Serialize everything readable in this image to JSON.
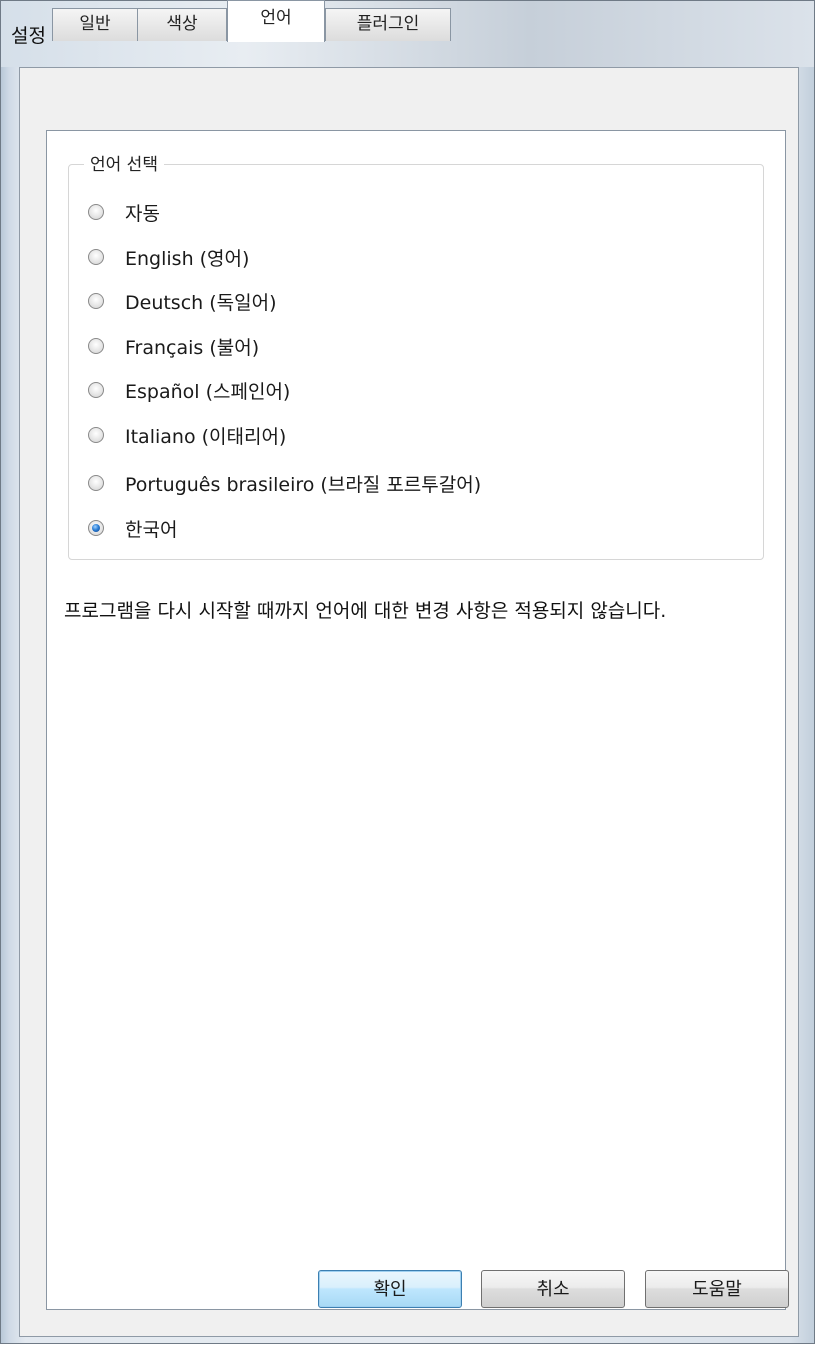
{
  "window": {
    "title": "설정"
  },
  "tabs": [
    {
      "label": "일반",
      "active": false
    },
    {
      "label": "색상",
      "active": false
    },
    {
      "label": "언어",
      "active": true
    },
    {
      "label": "플러그인",
      "active": false
    }
  ],
  "language_group": {
    "legend": "언어 선택",
    "options": [
      {
        "label": "자동",
        "checked": false
      },
      {
        "label": "English (영어)",
        "checked": false
      },
      {
        "label": "Deutsch (독일어)",
        "checked": false
      },
      {
        "label": "Français (불어)",
        "checked": false
      },
      {
        "label": "Español (스페인어)",
        "checked": false
      },
      {
        "label": "Italiano (이태리어)",
        "checked": false
      },
      {
        "label": "Português brasileiro (브라질 포르투갈어)",
        "checked": false
      },
      {
        "label": "한국어",
        "checked": true
      }
    ]
  },
  "note": "프로그램을 다시 시작할 때까지 언어에 대한 변경 사항은 적용되지 않습니다.",
  "buttons": {
    "ok": "확인",
    "cancel": "취소",
    "help": "도움말"
  }
}
